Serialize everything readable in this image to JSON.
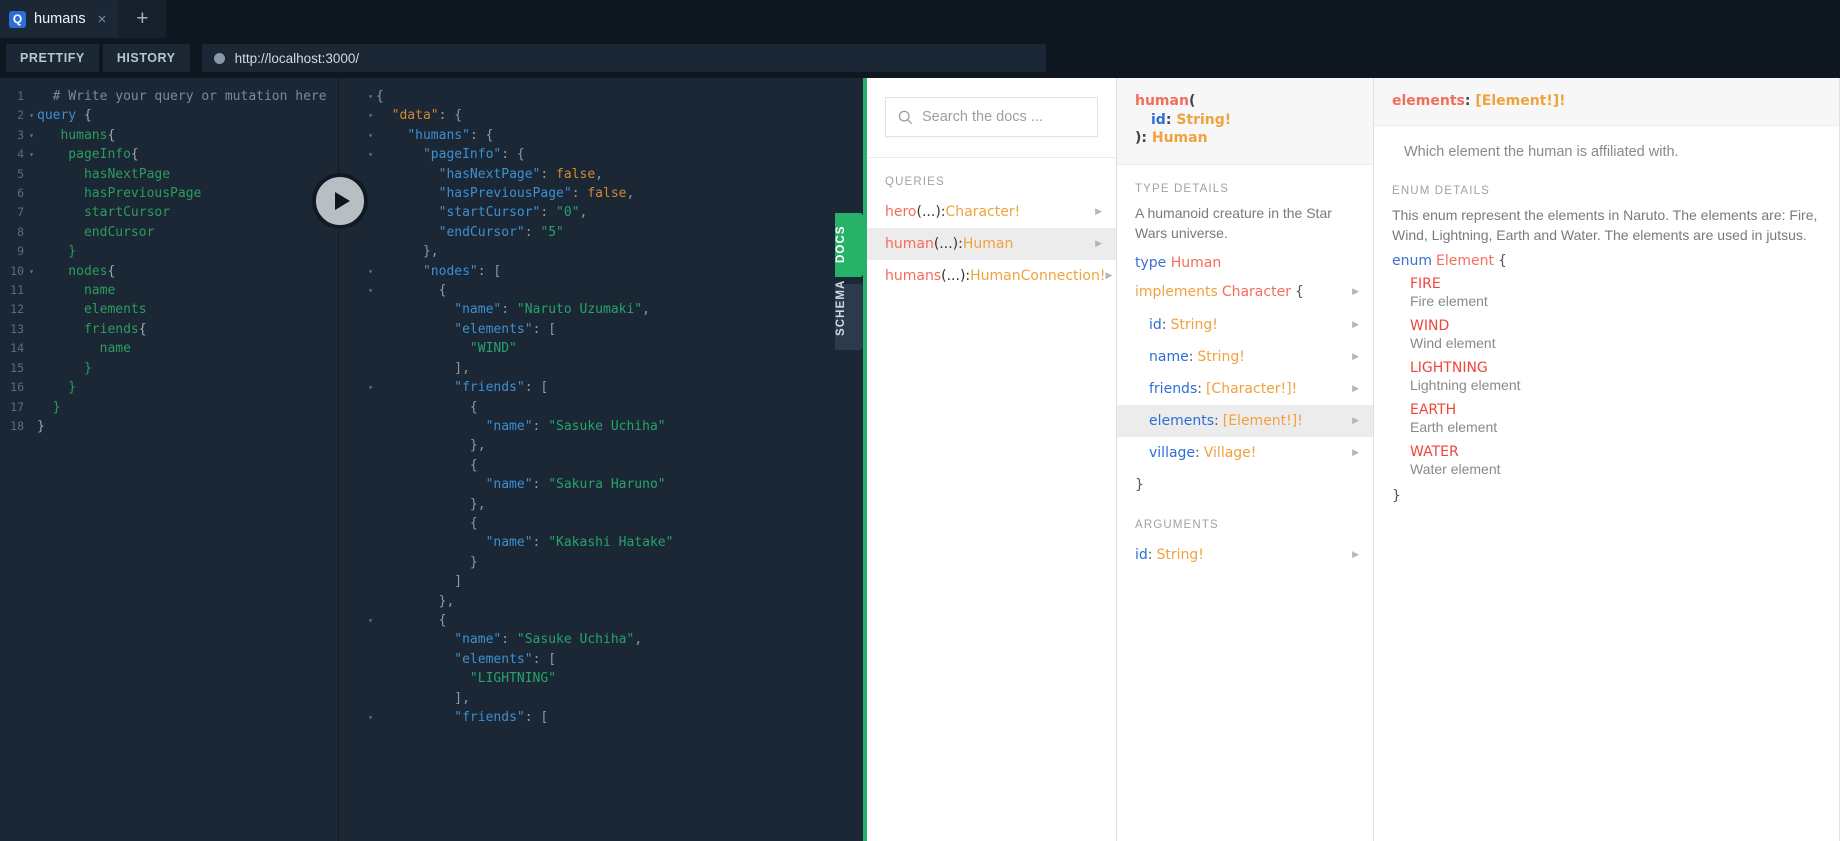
{
  "tabbar": {
    "tab_badge": "Q",
    "tab_label": "humans",
    "close_icon": "×",
    "add_icon": "+"
  },
  "toolbar": {
    "prettify_label": "PRETTIFY",
    "history_label": "HISTORY",
    "url": "http://localhost:3000/"
  },
  "execute": {
    "label": "▶"
  },
  "vtabs": {
    "docs": "DOCS",
    "schema": "SCHEMA"
  },
  "editor": {
    "lines": [
      {
        "n": "1",
        "fold": "",
        "segs": [
          {
            "t": "  # Write your query or mutation here",
            "c": "k-comment"
          }
        ]
      },
      {
        "n": "2",
        "fold": "▾",
        "segs": [
          {
            "t": "query ",
            "c": "k-kw"
          },
          {
            "t": "{",
            "c": "k-punc"
          }
        ]
      },
      {
        "n": "3",
        "fold": "▾",
        "segs": [
          {
            "t": "   humans",
            "c": "k-field"
          },
          {
            "t": "{",
            "c": "k-punc"
          }
        ]
      },
      {
        "n": "4",
        "fold": "▾",
        "segs": [
          {
            "t": "    pageInfo",
            "c": "k-field"
          },
          {
            "t": "{",
            "c": "k-punc"
          }
        ]
      },
      {
        "n": "5",
        "fold": "",
        "segs": [
          {
            "t": "      hasNextPage",
            "c": "k-field"
          }
        ]
      },
      {
        "n": "6",
        "fold": "",
        "segs": [
          {
            "t": "      hasPreviousPage",
            "c": "k-field"
          }
        ]
      },
      {
        "n": "7",
        "fold": "",
        "segs": [
          {
            "t": "      startCursor",
            "c": "k-field"
          }
        ]
      },
      {
        "n": "8",
        "fold": "",
        "segs": [
          {
            "t": "      endCursor",
            "c": "k-field"
          }
        ]
      },
      {
        "n": "9",
        "fold": "",
        "segs": [
          {
            "t": "    }",
            "c": "k-field"
          }
        ]
      },
      {
        "n": "10",
        "fold": "▾",
        "segs": [
          {
            "t": "    nodes",
            "c": "k-field"
          },
          {
            "t": "{",
            "c": "k-punc"
          }
        ]
      },
      {
        "n": "11",
        "fold": "",
        "segs": [
          {
            "t": "      name",
            "c": "k-field"
          }
        ]
      },
      {
        "n": "12",
        "fold": "",
        "segs": [
          {
            "t": "      elements",
            "c": "k-field"
          }
        ]
      },
      {
        "n": "13",
        "fold": "",
        "segs": [
          {
            "t": "      friends",
            "c": "k-field"
          },
          {
            "t": "{",
            "c": "k-punc"
          }
        ]
      },
      {
        "n": "14",
        "fold": "",
        "segs": [
          {
            "t": "        name",
            "c": "k-field"
          }
        ]
      },
      {
        "n": "15",
        "fold": "",
        "segs": [
          {
            "t": "      }",
            "c": "k-field"
          }
        ]
      },
      {
        "n": "16",
        "fold": "",
        "segs": [
          {
            "t": "    }",
            "c": "k-field"
          }
        ]
      },
      {
        "n": "17",
        "fold": "",
        "segs": [
          {
            "t": "  }",
            "c": "k-field"
          }
        ]
      },
      {
        "n": "18",
        "fold": "",
        "segs": [
          {
            "t": "}",
            "c": "k-punc"
          }
        ]
      }
    ]
  },
  "result": {
    "lines": [
      {
        "fold": "▾",
        "segs": [
          {
            "t": "{",
            "c": "r-punc"
          }
        ]
      },
      {
        "fold": "▾",
        "segs": [
          {
            "t": "  ",
            "c": "r-punc"
          },
          {
            "t": "\"data\"",
            "c": "r-bool"
          },
          {
            "t": ": {",
            "c": "r-punc"
          }
        ]
      },
      {
        "fold": "▾",
        "segs": [
          {
            "t": "    ",
            "c": "r-punc"
          },
          {
            "t": "\"humans\"",
            "c": "r-key"
          },
          {
            "t": ": {",
            "c": "r-punc"
          }
        ]
      },
      {
        "fold": "▾",
        "segs": [
          {
            "t": "      ",
            "c": "r-punc"
          },
          {
            "t": "\"pageInfo\"",
            "c": "r-key"
          },
          {
            "t": ": {",
            "c": "r-punc"
          }
        ]
      },
      {
        "fold": "",
        "segs": [
          {
            "t": "        ",
            "c": "r-punc"
          },
          {
            "t": "\"hasNextPage\"",
            "c": "r-key"
          },
          {
            "t": ": ",
            "c": "r-punc"
          },
          {
            "t": "false",
            "c": "r-bool"
          },
          {
            "t": ",",
            "c": "r-punc"
          }
        ]
      },
      {
        "fold": "",
        "segs": [
          {
            "t": "        ",
            "c": "r-punc"
          },
          {
            "t": "\"hasPreviousPage\"",
            "c": "r-key"
          },
          {
            "t": ": ",
            "c": "r-punc"
          },
          {
            "t": "false",
            "c": "r-bool"
          },
          {
            "t": ",",
            "c": "r-punc"
          }
        ]
      },
      {
        "fold": "",
        "segs": [
          {
            "t": "        ",
            "c": "r-punc"
          },
          {
            "t": "\"startCursor\"",
            "c": "r-key"
          },
          {
            "t": ": ",
            "c": "r-punc"
          },
          {
            "t": "\"0\"",
            "c": "r-str"
          },
          {
            "t": ",",
            "c": "r-punc"
          }
        ]
      },
      {
        "fold": "",
        "segs": [
          {
            "t": "        ",
            "c": "r-punc"
          },
          {
            "t": "\"endCursor\"",
            "c": "r-key"
          },
          {
            "t": ": ",
            "c": "r-punc"
          },
          {
            "t": "\"5\"",
            "c": "r-str"
          }
        ]
      },
      {
        "fold": "",
        "segs": [
          {
            "t": "      },",
            "c": "r-punc"
          }
        ]
      },
      {
        "fold": "▾",
        "segs": [
          {
            "t": "      ",
            "c": "r-punc"
          },
          {
            "t": "\"nodes\"",
            "c": "r-key"
          },
          {
            "t": ": [",
            "c": "r-punc"
          }
        ]
      },
      {
        "fold": "▾",
        "segs": [
          {
            "t": "        {",
            "c": "r-punc"
          }
        ]
      },
      {
        "fold": "",
        "segs": [
          {
            "t": "          ",
            "c": "r-punc"
          },
          {
            "t": "\"name\"",
            "c": "r-key"
          },
          {
            "t": ": ",
            "c": "r-punc"
          },
          {
            "t": "\"Naruto Uzumaki\"",
            "c": "r-str"
          },
          {
            "t": ",",
            "c": "r-punc"
          }
        ]
      },
      {
        "fold": "",
        "segs": [
          {
            "t": "          ",
            "c": "r-punc"
          },
          {
            "t": "\"elements\"",
            "c": "r-key"
          },
          {
            "t": ": [",
            "c": "r-punc"
          }
        ]
      },
      {
        "fold": "",
        "segs": [
          {
            "t": "            ",
            "c": "r-punc"
          },
          {
            "t": "\"WIND\"",
            "c": "r-str"
          }
        ]
      },
      {
        "fold": "",
        "segs": [
          {
            "t": "          ],",
            "c": "r-punc"
          }
        ]
      },
      {
        "fold": "▾",
        "segs": [
          {
            "t": "          ",
            "c": "r-punc"
          },
          {
            "t": "\"friends\"",
            "c": "r-key"
          },
          {
            "t": ": [",
            "c": "r-punc"
          }
        ]
      },
      {
        "fold": "",
        "segs": [
          {
            "t": "            {",
            "c": "r-punc"
          }
        ]
      },
      {
        "fold": "",
        "segs": [
          {
            "t": "              ",
            "c": "r-punc"
          },
          {
            "t": "\"name\"",
            "c": "r-key"
          },
          {
            "t": ": ",
            "c": "r-punc"
          },
          {
            "t": "\"Sasuke Uchiha\"",
            "c": "r-str"
          }
        ]
      },
      {
        "fold": "",
        "segs": [
          {
            "t": "            },",
            "c": "r-punc"
          }
        ]
      },
      {
        "fold": "",
        "segs": [
          {
            "t": "            {",
            "c": "r-punc"
          }
        ]
      },
      {
        "fold": "",
        "segs": [
          {
            "t": "              ",
            "c": "r-punc"
          },
          {
            "t": "\"name\"",
            "c": "r-key"
          },
          {
            "t": ": ",
            "c": "r-punc"
          },
          {
            "t": "\"Sakura Haruno\"",
            "c": "r-str"
          }
        ]
      },
      {
        "fold": "",
        "segs": [
          {
            "t": "            },",
            "c": "r-punc"
          }
        ]
      },
      {
        "fold": "",
        "segs": [
          {
            "t": "            {",
            "c": "r-punc"
          }
        ]
      },
      {
        "fold": "",
        "segs": [
          {
            "t": "              ",
            "c": "r-punc"
          },
          {
            "t": "\"name\"",
            "c": "r-key"
          },
          {
            "t": ": ",
            "c": "r-punc"
          },
          {
            "t": "\"Kakashi Hatake\"",
            "c": "r-str"
          }
        ]
      },
      {
        "fold": "",
        "segs": [
          {
            "t": "            }",
            "c": "r-punc"
          }
        ]
      },
      {
        "fold": "",
        "segs": [
          {
            "t": "          ]",
            "c": "r-punc"
          }
        ]
      },
      {
        "fold": "",
        "segs": [
          {
            "t": "        },",
            "c": "r-punc"
          }
        ]
      },
      {
        "fold": "▾",
        "segs": [
          {
            "t": "        {",
            "c": "r-punc"
          }
        ]
      },
      {
        "fold": "",
        "segs": [
          {
            "t": "          ",
            "c": "r-punc"
          },
          {
            "t": "\"name\"",
            "c": "r-key"
          },
          {
            "t": ": ",
            "c": "r-punc"
          },
          {
            "t": "\"Sasuke Uchiha\"",
            "c": "r-str"
          },
          {
            "t": ",",
            "c": "r-punc"
          }
        ]
      },
      {
        "fold": "",
        "segs": [
          {
            "t": "          ",
            "c": "r-punc"
          },
          {
            "t": "\"elements\"",
            "c": "r-key"
          },
          {
            "t": ": [",
            "c": "r-punc"
          }
        ]
      },
      {
        "fold": "",
        "segs": [
          {
            "t": "            ",
            "c": "r-punc"
          },
          {
            "t": "\"LIGHTNING\"",
            "c": "r-str"
          }
        ]
      },
      {
        "fold": "",
        "segs": [
          {
            "t": "          ],",
            "c": "r-punc"
          }
        ]
      },
      {
        "fold": "▾",
        "segs": [
          {
            "t": "          ",
            "c": "r-punc"
          },
          {
            "t": "\"friends\"",
            "c": "r-key"
          },
          {
            "t": ": [",
            "c": "r-punc"
          }
        ]
      }
    ]
  },
  "docs": {
    "search_placeholder": "Search the docs ...",
    "search_icon": "search-icon",
    "queries_heading": "QUERIES",
    "queries": [
      {
        "name": "hero",
        "args": "(...)",
        "colon": ": ",
        "type": "Character!",
        "selected": false
      },
      {
        "name": "human",
        "args": "(...)",
        "colon": ": ",
        "type": "Human",
        "selected": true
      },
      {
        "name": "humans",
        "args": "(...)",
        "colon": ": ",
        "type": "HumanConnection!",
        "selected": false
      }
    ]
  },
  "type_col": {
    "signature": {
      "line1_fn": "human",
      "line1_paren": "(",
      "line2_arg": "id",
      "line2_colon": ": ",
      "line2_type": "String!",
      "line3_close": "): ",
      "line3_type": "Human"
    },
    "type_details_heading": "TYPE DETAILS",
    "description": "A humanoid creature in the Star Wars universe.",
    "type_keyword": "type",
    "type_name": "Human",
    "implements_keyword": "implements",
    "implements_type": "Character",
    "implements_brace": "{",
    "fields": [
      {
        "name": "id",
        "colon": ": ",
        "type": "String!",
        "selected": false
      },
      {
        "name": "name",
        "colon": ": ",
        "type": "String!",
        "selected": false
      },
      {
        "name": "friends",
        "colon": ": ",
        "type": "[Character!]!",
        "selected": false
      },
      {
        "name": "elements",
        "colon": ": ",
        "type": "[Element!]!",
        "selected": true
      },
      {
        "name": "village",
        "colon": ": ",
        "type": "Village!",
        "selected": false
      }
    ],
    "closing_brace": "}",
    "arguments_heading": "ARGUMENTS",
    "arguments": [
      {
        "name": "id",
        "colon": ": ",
        "type": "String!"
      }
    ]
  },
  "field_col": {
    "header_name": "elements",
    "header_colon": ": ",
    "header_type": "[Element!]!",
    "description": "Which element the human is affiliated with.",
    "enum_details_heading": "ENUM DETAILS",
    "enum_description": "This enum represent the elements in Naruto. The elements are: Fire, Wind, Lightning, Earth and Water. The elements are used in jutsus.",
    "enum_keyword": "enum",
    "enum_name": "Element",
    "enum_brace": "{",
    "enum_values": [
      {
        "value": "FIRE",
        "desc": "Fire element"
      },
      {
        "value": "WIND",
        "desc": "Wind element"
      },
      {
        "value": "LIGHTNING",
        "desc": "Lightning element"
      },
      {
        "value": "EARTH",
        "desc": "Earth element"
      },
      {
        "value": "WATER",
        "desc": "Water element"
      }
    ],
    "enum_close": "}"
  },
  "colors": {
    "accent_green": "#26b269",
    "editor_bg": "#1b2735",
    "chrome_bg": "#0e1620",
    "docs_bg": "#ffffff",
    "field_blue": "#2d6ed6",
    "type_orange": "#f0a23c",
    "name_red": "#f26d5b",
    "enum_red": "#f0453a"
  }
}
